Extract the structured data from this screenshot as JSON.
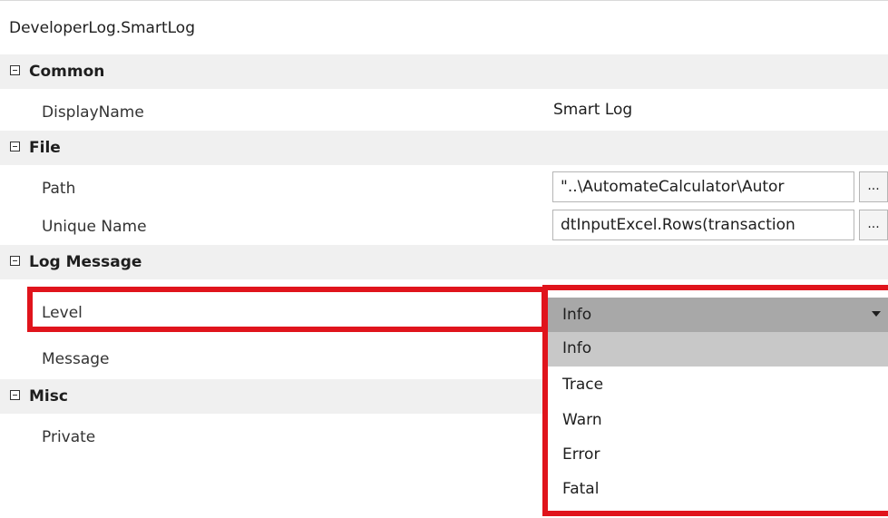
{
  "header": {
    "title": "DeveloperLog.SmartLog"
  },
  "categories": {
    "common": {
      "name": "Common"
    },
    "file": {
      "name": "File"
    },
    "log_message": {
      "name": "Log Message"
    },
    "misc": {
      "name": "Misc"
    }
  },
  "properties": {
    "display_name": {
      "label": "DisplayName",
      "value": "Smart Log"
    },
    "path": {
      "label": "Path",
      "value": "\"..\\AutomateCalculator\\Autor",
      "button": "..."
    },
    "unique_name": {
      "label": "Unique Name",
      "value": "dtInputExcel.Rows(transaction",
      "button": "..."
    },
    "level": {
      "label": "Level",
      "value": "Info"
    },
    "message": {
      "label": "Message"
    },
    "private": {
      "label": "Private"
    }
  },
  "level_dropdown": {
    "selected": "Info",
    "options": [
      "Info",
      "Trace",
      "Warn",
      "Error",
      "Fatal"
    ]
  },
  "colors": {
    "highlight": "#e0141c",
    "category_bg": "#f0f0f0",
    "selected_option": "#c8c8c8"
  }
}
